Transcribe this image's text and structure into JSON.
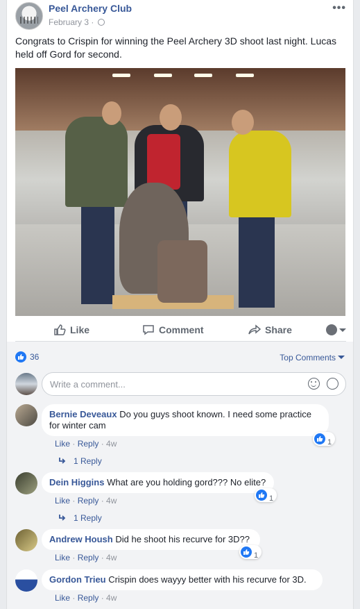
{
  "post": {
    "page_name": "Peel Archery Club",
    "date": "February 3",
    "separator": "·",
    "more": "•••",
    "text": "Congrats to Crispin for winning the Peel Archery 3D shoot last night. Lucas held off Gord for second."
  },
  "actions": {
    "like": "Like",
    "comment": "Comment",
    "share": "Share"
  },
  "reactions": {
    "count": "36",
    "sort_label": "Top Comments"
  },
  "write_comment": {
    "placeholder": "Write a comment..."
  },
  "comments": [
    {
      "author": "Bernie Deveaux",
      "text": "Do you guys shoot known. I need some practice for winter cam",
      "like": "Like",
      "reply": "Reply",
      "age": "4w",
      "reactions": "1",
      "replies": "1 Reply"
    },
    {
      "author": "Dein Higgins",
      "text": "What are you holding gord??? No elite?",
      "like": "Like",
      "reply": "Reply",
      "age": "4w",
      "reactions": "1",
      "replies": "1 Reply"
    },
    {
      "author": "Andrew Housh",
      "text": "Did he shoot his recurve for 3D??",
      "like": "Like",
      "reply": "Reply",
      "age": "4w",
      "reactions": "1"
    },
    {
      "author": "Gordon Trieu",
      "text": "Crispin does wayyy better with his recurve for 3D.",
      "like": "Like",
      "reply": "Reply",
      "age": "4w"
    }
  ],
  "colors": {
    "link": "#385898",
    "like_blue": "#2078f4",
    "meta": "#90949c",
    "background": "#e9ebee"
  },
  "icons": [
    "page-avatar",
    "globe-icon",
    "more-icon",
    "like-icon",
    "comment-icon",
    "share-icon",
    "emoji-icon",
    "sticker-icon",
    "reply-arrow-icon"
  ]
}
